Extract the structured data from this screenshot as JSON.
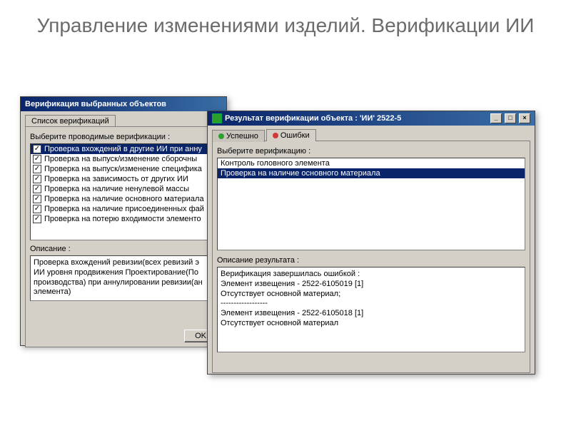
{
  "slide_title": "Управление изменениями изделий. Верификации ИИ",
  "left_window": {
    "title": "Верификация выбранных объектов",
    "tab_label": "Список верификаций",
    "prompt": "Выберите проводимые верификации :",
    "items": [
      "Проверка вхождений в другие ИИ при анну",
      "Проверка на выпуск/изменение сборочны",
      "Проверка на выпуск/изменение специфика",
      "Проверка на зависимость от других ИИ",
      "Проверка на наличие ненулевой массы",
      "Проверка на наличие основного материала",
      "Проверка на наличие присоединенных фай",
      "Проверка на потерю входимости элементо"
    ],
    "desc_label": "Описание :",
    "desc_text": "Проверка вхождений ревизии(всех ревизий э\nИИ уровня продвижения Проектирование(По\nпроизводства) при аннулировании ревизии(ан\nэлемента)",
    "ok_label": "OK"
  },
  "right_window": {
    "title": "Результат верификации объекта : 'ИИ' 2522-5",
    "tab_success": "Успешно",
    "tab_errors": "Ошибки",
    "prompt": "Выберите верификацию :",
    "verifications": [
      "Контроль головного элемента",
      "Проверка на наличие основного материала"
    ],
    "result_label": "Описание результата :",
    "result_text": "Верификация завершилась ошибкой :\nЭлемент извещения - 2522-6105019 [1]\nОтсутствует основной материал;\n------------------\nЭлемент извещения - 2522-6105018 [1]\nОтсутствует основной материал"
  }
}
